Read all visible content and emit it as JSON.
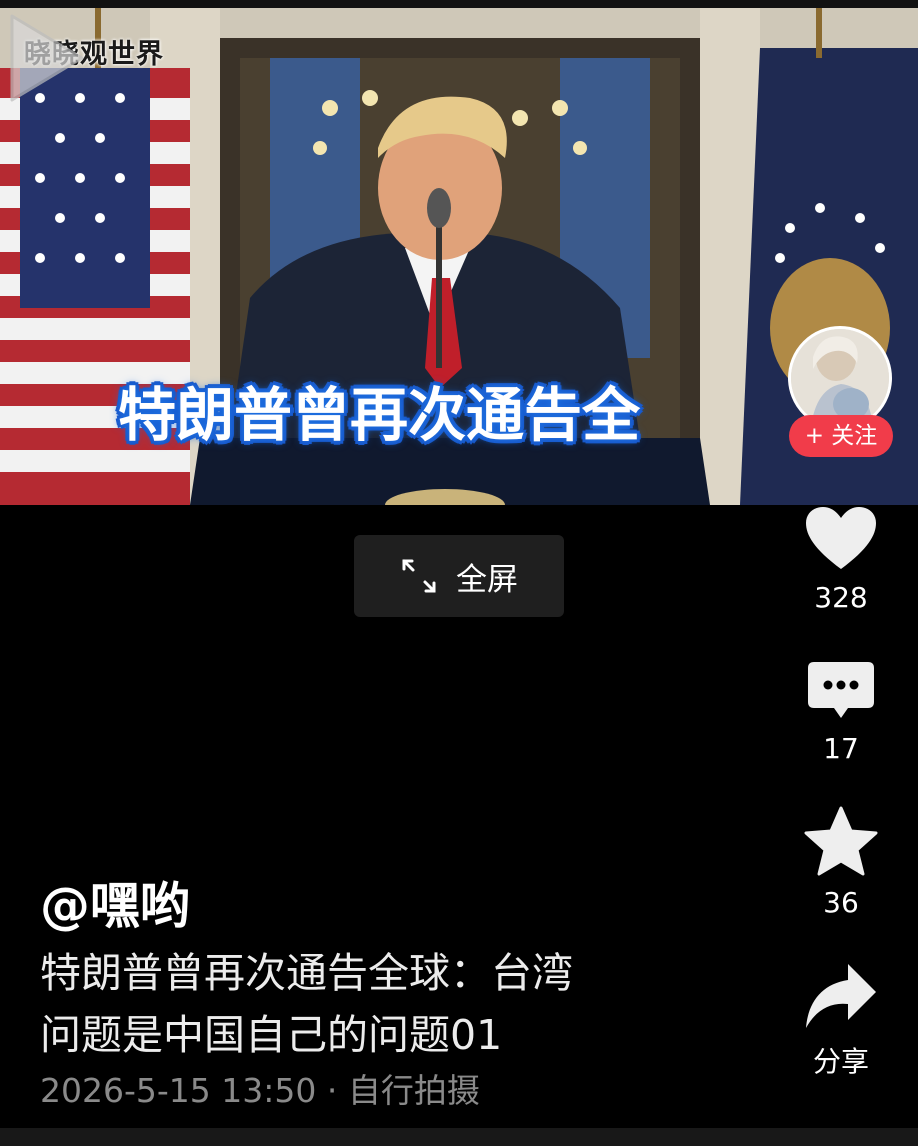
{
  "video": {
    "watermark": "晓晓观世界",
    "subtitle": "特朗普曾再次通告全"
  },
  "follow": {
    "label": "+ 关注"
  },
  "fullscreen": {
    "label": "全屏",
    "icon": "expand-icon"
  },
  "rail": {
    "like": {
      "icon": "heart-icon",
      "count": "328"
    },
    "comment": {
      "icon": "comment-icon",
      "count": "17"
    },
    "favorite": {
      "icon": "star-icon",
      "count": "36"
    },
    "share": {
      "icon": "share-icon",
      "label": "分享"
    }
  },
  "post": {
    "author": "@嘿哟",
    "description_line1": "特朗普曾再次通告全球：台湾",
    "description_line2": "问题是中国自己的问题01",
    "meta": "2026-5-15 13:50 · 自行拍摄"
  },
  "colors": {
    "background": "#000000",
    "follow_red": "#f13c4a",
    "subtitle_blue": "#1856c8",
    "meta_gray": "#8a8a8a"
  }
}
